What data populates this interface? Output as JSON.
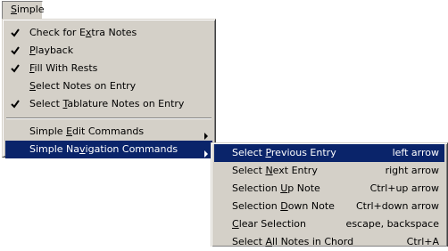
{
  "menubar": {
    "simple": {
      "pre": "",
      "u": "S",
      "post": "imple"
    }
  },
  "main_menu": {
    "items": [
      {
        "pre": "Check for E",
        "u": "x",
        "post": "tra Notes",
        "checked": true
      },
      {
        "pre": "",
        "u": "P",
        "post": "layback",
        "checked": true
      },
      {
        "pre": "",
        "u": "F",
        "post": "ill With Rests",
        "checked": true
      },
      {
        "pre": "",
        "u": "S",
        "post": "elect Notes on Entry",
        "checked": false
      },
      {
        "pre": "Select ",
        "u": "T",
        "post": "ablature Notes on Entry",
        "checked": true
      },
      {
        "pre": "Simple ",
        "u": "E",
        "post": "dit Commands",
        "submenu": true
      },
      {
        "pre": "Simple Na",
        "u": "v",
        "post": "igation Commands",
        "submenu": true,
        "highlighted": true
      }
    ]
  },
  "sub_menu": {
    "items": [
      {
        "pre": "Select ",
        "u": "P",
        "post": "revious Entry",
        "shortcut": "left arrow",
        "highlighted": true
      },
      {
        "pre": "Select ",
        "u": "N",
        "post": "ext Entry",
        "shortcut": "right arrow"
      },
      {
        "pre": "Selection ",
        "u": "U",
        "post": "p Note",
        "shortcut": "Ctrl+up arrow"
      },
      {
        "pre": "Selection ",
        "u": "D",
        "post": "own Note",
        "shortcut": "Ctrl+down arrow"
      },
      {
        "pre": "",
        "u": "C",
        "post": "lear Selection",
        "shortcut": "escape, backspace"
      },
      {
        "pre": "Select ",
        "u": "A",
        "post": "ll Notes in Chord",
        "shortcut": "Ctrl+A"
      }
    ]
  },
  "colors": {
    "menu_face": "#d4d0c8",
    "highlight": "#0a246a",
    "highlight_text": "#ffffff"
  },
  "icons": {
    "check": "check-mark-icon",
    "submenu": "submenu-arrow-icon"
  }
}
